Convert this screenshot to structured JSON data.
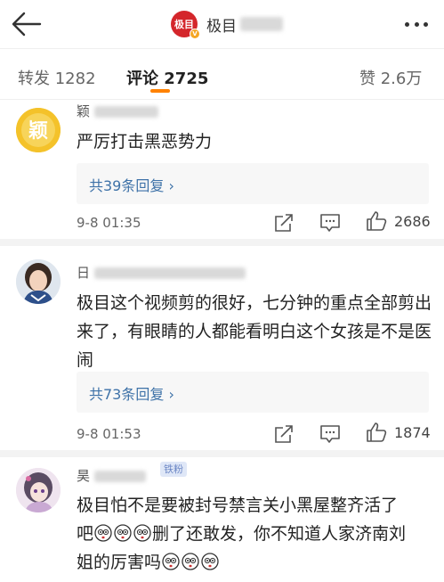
{
  "header": {
    "logo_text": "极目",
    "title": "极目",
    "back_icon": "back-arrow-icon",
    "more_icon": "more-dots-icon"
  },
  "tabs": [
    {
      "label": "转发 1282"
    },
    {
      "label": "评论 2725"
    },
    {
      "label": "赞 2.6万"
    }
  ],
  "comments": [
    {
      "username": "颖",
      "content": "严厉打击黑恶势力",
      "replies": "共39条回复 ›",
      "time": "9-8 01:35",
      "likes": "2686",
      "avatar": "yellow-badge-avatar"
    },
    {
      "username": "日",
      "content": "极目这个视频剪的很好，七分钟的重点全部剪出来了，有眼睛的人都能看明白这个女孩是不是医闹",
      "replies": "共73条回复 ›",
      "time": "9-8 01:53",
      "likes": "1874",
      "avatar": "woman-portrait-avatar"
    },
    {
      "username": "昊",
      "fan_badge": "铁粉",
      "content_lines": [
        "极目怕不是要被封号禁言关小黑屋整齐活了",
        "删了还敢发，你不知道人家济南刘",
        "姐的厉害吗"
      ],
      "avatar": "anime-girl-avatar"
    }
  ],
  "colors": {
    "accent": "#ff8200",
    "link": "#3e72a8",
    "logo_red": "#d4262b"
  }
}
